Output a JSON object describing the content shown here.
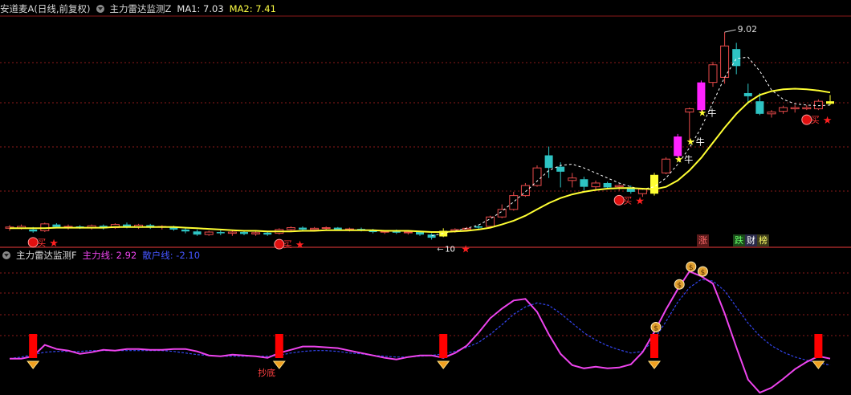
{
  "upper_header": {
    "stock": "安道麦A(日线,前复权)",
    "indicator": "主力雷达监测Z",
    "ma1_label": "MA1: 7.03",
    "ma2_label": "MA2: 7.41"
  },
  "lower_header": {
    "indicator": "主力雷达监测F",
    "main_line_label": "主力线: 2.92",
    "retail_line_label": "散户线: -2.10"
  },
  "badges": {
    "zhang": "涨",
    "die": "跌",
    "cai": "财",
    "bang": "榜"
  },
  "colors": {
    "background": "#000000",
    "grid": "#8b1a1a",
    "up_candle": "#e84a4a",
    "down_candle": "#2ec4c4",
    "strong_up": "#ff22ff",
    "ma_yellow": "#ffff33",
    "main_line": "#ee44ee",
    "retail_line": "#3344ee",
    "signal_bar": "#ff0000"
  },
  "chart_data": [
    {
      "type": "candlestick",
      "title": "安道麦A(日线,前复权)",
      "price_annotation": {
        "label": "9.02",
        "value": 9.02
      },
      "price_range": [
        5.7,
        9.25
      ],
      "moving_averages": [
        {
          "name": "MA1",
          "value": 7.03,
          "style": "dashed white"
        },
        {
          "name": "MA2",
          "value": 7.41,
          "style": "solid yellow"
        }
      ],
      "buy_signals": [
        {
          "label": "买",
          "bar": 2
        },
        {
          "label": "买",
          "bar": 23
        },
        {
          "label": "买",
          "bar": 52
        },
        {
          "label": "买",
          "bar": 68
        }
      ],
      "other_signals": [
        {
          "label": "10",
          "bar": 37
        }
      ],
      "hold_markers": {
        "label": "牛",
        "bars": [
          57,
          58,
          59
        ]
      },
      "bars": [
        {
          "o": 5.9,
          "h": 5.95,
          "l": 5.86,
          "c": 5.92,
          "k": "up"
        },
        {
          "o": 5.93,
          "h": 5.96,
          "l": 5.88,
          "c": 5.9,
          "k": "up"
        },
        {
          "o": 5.88,
          "h": 5.92,
          "l": 5.83,
          "c": 5.85,
          "k": "down"
        },
        {
          "o": 5.86,
          "h": 5.99,
          "l": 5.84,
          "c": 5.97,
          "k": "up"
        },
        {
          "o": 5.96,
          "h": 5.98,
          "l": 5.9,
          "c": 5.92,
          "k": "down"
        },
        {
          "o": 5.92,
          "h": 5.96,
          "l": 5.88,
          "c": 5.93,
          "k": "up"
        },
        {
          "o": 5.93,
          "h": 5.95,
          "l": 5.89,
          "c": 5.91,
          "k": "down"
        },
        {
          "o": 5.91,
          "h": 5.96,
          "l": 5.88,
          "c": 5.94,
          "k": "up"
        },
        {
          "o": 5.94,
          "h": 5.96,
          "l": 5.88,
          "c": 5.9,
          "k": "down"
        },
        {
          "o": 5.91,
          "h": 5.98,
          "l": 5.89,
          "c": 5.96,
          "k": "up"
        },
        {
          "o": 5.96,
          "h": 5.99,
          "l": 5.9,
          "c": 5.92,
          "k": "down"
        },
        {
          "o": 5.92,
          "h": 5.97,
          "l": 5.89,
          "c": 5.95,
          "k": "up"
        },
        {
          "o": 5.95,
          "h": 5.97,
          "l": 5.89,
          "c": 5.91,
          "k": "down"
        },
        {
          "o": 5.92,
          "h": 5.95,
          "l": 5.88,
          "c": 5.93,
          "k": "up"
        },
        {
          "o": 5.92,
          "h": 5.94,
          "l": 5.86,
          "c": 5.88,
          "k": "down"
        },
        {
          "o": 5.88,
          "h": 5.91,
          "l": 5.82,
          "c": 5.85,
          "k": "down"
        },
        {
          "o": 5.85,
          "h": 5.88,
          "l": 5.78,
          "c": 5.8,
          "k": "down"
        },
        {
          "o": 5.8,
          "h": 5.86,
          "l": 5.78,
          "c": 5.84,
          "k": "up"
        },
        {
          "o": 5.84,
          "h": 5.87,
          "l": 5.79,
          "c": 5.82,
          "k": "down"
        },
        {
          "o": 5.82,
          "h": 5.86,
          "l": 5.78,
          "c": 5.84,
          "k": "up"
        },
        {
          "o": 5.84,
          "h": 5.86,
          "l": 5.79,
          "c": 5.81,
          "k": "down"
        },
        {
          "o": 5.81,
          "h": 5.85,
          "l": 5.78,
          "c": 5.83,
          "k": "up"
        },
        {
          "o": 5.83,
          "h": 5.85,
          "l": 5.78,
          "c": 5.8,
          "k": "down"
        },
        {
          "o": 5.82,
          "h": 5.9,
          "l": 5.8,
          "c": 5.88,
          "k": "up"
        },
        {
          "o": 5.88,
          "h": 5.93,
          "l": 5.86,
          "c": 5.91,
          "k": "up"
        },
        {
          "o": 5.91,
          "h": 5.93,
          "l": 5.86,
          "c": 5.88,
          "k": "down"
        },
        {
          "o": 5.88,
          "h": 5.92,
          "l": 5.86,
          "c": 5.9,
          "k": "up"
        },
        {
          "o": 5.9,
          "h": 5.93,
          "l": 5.87,
          "c": 5.91,
          "k": "up"
        },
        {
          "o": 5.91,
          "h": 5.92,
          "l": 5.86,
          "c": 5.88,
          "k": "down"
        },
        {
          "o": 5.88,
          "h": 5.91,
          "l": 5.85,
          "c": 5.89,
          "k": "up"
        },
        {
          "o": 5.89,
          "h": 5.91,
          "l": 5.85,
          "c": 5.86,
          "k": "down"
        },
        {
          "o": 5.86,
          "h": 5.89,
          "l": 5.82,
          "c": 5.84,
          "k": "down"
        },
        {
          "o": 5.84,
          "h": 5.87,
          "l": 5.81,
          "c": 5.85,
          "k": "up"
        },
        {
          "o": 5.85,
          "h": 5.88,
          "l": 5.81,
          "c": 5.83,
          "k": "down"
        },
        {
          "o": 5.83,
          "h": 5.86,
          "l": 5.8,
          "c": 5.84,
          "k": "up"
        },
        {
          "o": 5.84,
          "h": 5.85,
          "l": 5.78,
          "c": 5.8,
          "k": "down"
        },
        {
          "o": 5.8,
          "h": 5.82,
          "l": 5.72,
          "c": 5.75,
          "k": "down"
        },
        {
          "o": 5.77,
          "h": 5.9,
          "l": 5.76,
          "c": 5.86,
          "k": "strong_yellow"
        },
        {
          "o": 5.86,
          "h": 5.9,
          "l": 5.83,
          "c": 5.88,
          "k": "up"
        },
        {
          "o": 5.88,
          "h": 5.92,
          "l": 5.85,
          "c": 5.9,
          "k": "up"
        },
        {
          "o": 5.91,
          "h": 5.96,
          "l": 5.88,
          "c": 5.93,
          "k": "down"
        },
        {
          "o": 5.93,
          "h": 6.1,
          "l": 5.91,
          "c": 6.08,
          "k": "up"
        },
        {
          "o": 6.08,
          "h": 6.28,
          "l": 6.06,
          "c": 6.2,
          "k": "up"
        },
        {
          "o": 6.2,
          "h": 6.48,
          "l": 6.18,
          "c": 6.42,
          "k": "up"
        },
        {
          "o": 6.42,
          "h": 6.62,
          "l": 6.4,
          "c": 6.58,
          "k": "up"
        },
        {
          "o": 6.58,
          "h": 6.9,
          "l": 6.56,
          "c": 6.86,
          "k": "up"
        },
        {
          "o": 6.86,
          "h": 7.2,
          "l": 6.7,
          "c": 7.06,
          "k": "down"
        },
        {
          "o": 6.8,
          "h": 6.95,
          "l": 6.55,
          "c": 6.88,
          "k": "down"
        },
        {
          "o": 6.66,
          "h": 6.78,
          "l": 6.55,
          "c": 6.7,
          "k": "up"
        },
        {
          "o": 6.68,
          "h": 6.72,
          "l": 6.5,
          "c": 6.56,
          "k": "down"
        },
        {
          "o": 6.56,
          "h": 6.66,
          "l": 6.52,
          "c": 6.62,
          "k": "up"
        },
        {
          "o": 6.62,
          "h": 6.64,
          "l": 6.52,
          "c": 6.55,
          "k": "down"
        },
        {
          "o": 6.56,
          "h": 6.6,
          "l": 6.5,
          "c": 6.58,
          "k": "up"
        },
        {
          "o": 6.55,
          "h": 6.58,
          "l": 6.45,
          "c": 6.48,
          "k": "down"
        },
        {
          "o": 6.45,
          "h": 6.54,
          "l": 6.4,
          "c": 6.52,
          "k": "up"
        },
        {
          "o": 6.45,
          "h": 6.78,
          "l": 6.42,
          "c": 6.75,
          "k": "strong_yellow"
        },
        {
          "o": 6.78,
          "h": 7.03,
          "l": 6.76,
          "c": 7.0,
          "k": "up"
        },
        {
          "o": 7.05,
          "h": 7.4,
          "l": 7.02,
          "c": 7.36,
          "k": "strong_magenta"
        },
        {
          "o": 7.75,
          "h": 7.82,
          "l": 7.3,
          "c": 7.8,
          "k": "up"
        },
        {
          "o": 7.78,
          "h": 8.25,
          "l": 7.76,
          "c": 8.22,
          "k": "strong_magenta"
        },
        {
          "o": 8.22,
          "h": 8.55,
          "l": 8.15,
          "c": 8.5,
          "k": "up"
        },
        {
          "o": 8.3,
          "h": 9.02,
          "l": 8.2,
          "c": 8.8,
          "k": "up"
        },
        {
          "o": 8.75,
          "h": 8.85,
          "l": 8.35,
          "c": 8.48,
          "k": "down"
        },
        {
          "o": 8.05,
          "h": 8.2,
          "l": 7.88,
          "c": 8.0,
          "k": "down"
        },
        {
          "o": 7.92,
          "h": 8.05,
          "l": 7.7,
          "c": 7.72,
          "k": "down"
        },
        {
          "o": 7.72,
          "h": 7.78,
          "l": 7.66,
          "c": 7.75,
          "k": "up"
        },
        {
          "o": 7.76,
          "h": 7.85,
          "l": 7.72,
          "c": 7.82,
          "k": "up"
        },
        {
          "o": 7.8,
          "h": 7.86,
          "l": 7.74,
          "c": 7.82,
          "k": "up"
        },
        {
          "o": 7.82,
          "h": 7.86,
          "l": 7.78,
          "c": 7.8,
          "k": "up"
        },
        {
          "o": 7.8,
          "h": 7.95,
          "l": 7.78,
          "c": 7.92,
          "k": "up"
        },
        {
          "o": 7.92,
          "h": 8.02,
          "l": 7.86,
          "c": 7.88,
          "k": "strong_yellow"
        }
      ],
      "ma2_values": [
        5.9,
        5.9,
        5.9,
        5.9,
        5.91,
        5.91,
        5.91,
        5.91,
        5.91,
        5.92,
        5.92,
        5.92,
        5.92,
        5.92,
        5.92,
        5.91,
        5.9,
        5.89,
        5.88,
        5.87,
        5.86,
        5.86,
        5.85,
        5.85,
        5.85,
        5.86,
        5.86,
        5.87,
        5.87,
        5.87,
        5.87,
        5.87,
        5.86,
        5.86,
        5.86,
        5.85,
        5.84,
        5.84,
        5.85,
        5.86,
        5.88,
        5.91,
        5.96,
        6.02,
        6.1,
        6.2,
        6.3,
        6.38,
        6.44,
        6.48,
        6.51,
        6.53,
        6.54,
        6.54,
        6.53,
        6.52,
        6.56,
        6.66,
        6.82,
        7.02,
        7.26,
        7.5,
        7.72,
        7.9,
        8.02,
        8.08,
        8.11,
        8.12,
        8.11,
        8.09,
        8.06
      ],
      "ma1_values": [
        null,
        null,
        null,
        null,
        null,
        null,
        null,
        null,
        null,
        null,
        null,
        null,
        null,
        null,
        null,
        null,
        null,
        null,
        null,
        null,
        null,
        null,
        null,
        null,
        null,
        null,
        null,
        null,
        null,
        null,
        null,
        null,
        null,
        null,
        null,
        null,
        5.78,
        5.82,
        5.86,
        5.9,
        5.95,
        6.05,
        6.17,
        6.32,
        6.48,
        6.65,
        6.82,
        6.9,
        6.92,
        6.86,
        6.78,
        6.7,
        6.62,
        6.56,
        6.52,
        6.56,
        6.7,
        6.92,
        7.18,
        7.5,
        7.9,
        8.3,
        8.6,
        8.62,
        8.4,
        8.1,
        7.95,
        7.88,
        7.86,
        7.85,
        7.86
      ]
    },
    {
      "type": "line",
      "title": "主力雷达监测F",
      "y_range": [
        -4.5,
        12
      ],
      "series": [
        {
          "name": "主力线",
          "values": [
            0.0,
            0.0,
            0.3,
            1.7,
            1.2,
            1.0,
            0.6,
            0.8,
            1.1,
            1.0,
            1.2,
            1.2,
            1.1,
            1.1,
            1.2,
            1.2,
            0.9,
            0.4,
            0.3,
            0.5,
            0.4,
            0.3,
            0.1,
            0.7,
            1.1,
            1.5,
            1.5,
            1.4,
            1.3,
            1.0,
            0.7,
            0.4,
            0.1,
            -0.1,
            0.2,
            0.4,
            0.4,
            0.1,
            0.7,
            1.6,
            3.2,
            5.0,
            6.2,
            7.2,
            7.4,
            5.8,
            3.0,
            0.6,
            -0.8,
            -1.2,
            -1.0,
            -1.2,
            -1.1,
            -0.7,
            0.8,
            3.3,
            6.1,
            8.6,
            10.8,
            10.2,
            9.3,
            5.6,
            1.4,
            -2.6,
            -4.2,
            -3.6,
            -2.5,
            -1.3,
            -0.4,
            0.3,
            0.0
          ]
        },
        {
          "name": "散户线",
          "values": [
            0.0,
            0.2,
            0.5,
            0.8,
            0.9,
            0.9,
            0.9,
            1.0,
            1.0,
            1.0,
            1.0,
            1.0,
            1.0,
            1.0,
            0.9,
            0.7,
            0.5,
            0.4,
            0.3,
            0.3,
            0.3,
            0.3,
            0.3,
            0.4,
            0.7,
            0.9,
            1.0,
            1.0,
            0.9,
            0.7,
            0.6,
            0.4,
            0.3,
            0.2,
            0.2,
            0.3,
            0.4,
            0.6,
            0.9,
            1.4,
            2.0,
            3.0,
            4.2,
            5.5,
            6.4,
            6.9,
            6.6,
            5.6,
            4.4,
            3.2,
            2.3,
            1.6,
            1.1,
            0.7,
            0.9,
            2.4,
            4.6,
            7.0,
            8.8,
            9.8,
            9.6,
            8.4,
            6.4,
            4.4,
            2.8,
            1.6,
            0.8,
            0.2,
            -0.2,
            -0.5,
            -0.8
          ]
        }
      ],
      "signal_bars": [
        2,
        23,
        37,
        55,
        69
      ],
      "bottom_label": {
        "text": "抄底",
        "bar": 22
      },
      "money_bag_bars": [
        55,
        57,
        58,
        59
      ]
    }
  ]
}
